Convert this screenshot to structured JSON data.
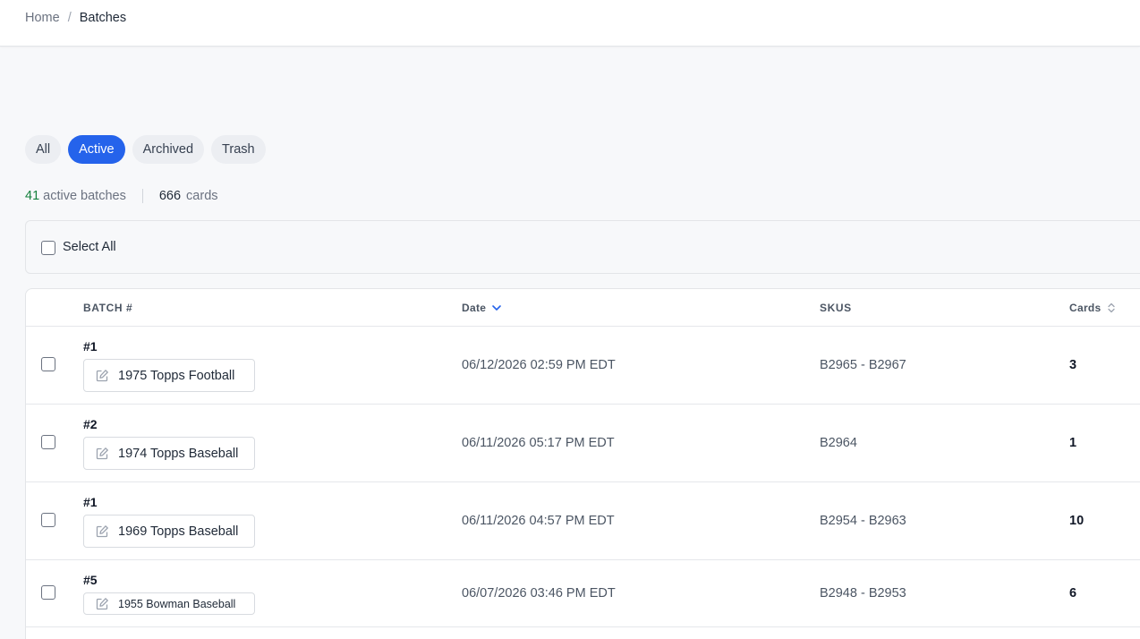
{
  "breadcrumb": {
    "home": "Home",
    "separator": "/",
    "current": "Batches"
  },
  "tabs": [
    {
      "label": "All",
      "active": false
    },
    {
      "label": "Active",
      "active": true
    },
    {
      "label": "Archived",
      "active": false
    },
    {
      "label": "Trash",
      "active": false
    }
  ],
  "stats": {
    "active_count": "41",
    "active_label": "active batches",
    "cards_count": "666",
    "cards_label": "cards"
  },
  "select_all": {
    "label": "Select All",
    "checked": false
  },
  "table": {
    "headers": {
      "batch": "BATCH #",
      "date": "Date",
      "skus": "SKUS",
      "cards": "Cards"
    },
    "sort": {
      "column": "Date",
      "direction": "desc"
    },
    "rows": [
      {
        "batch_num": "#1",
        "name": "1975 Topps Football",
        "date": "06/12/2026 02:59 PM EDT",
        "skus": "B2965 - B2967",
        "cards": "3"
      },
      {
        "batch_num": "#2",
        "name": "1974 Topps Baseball",
        "date": "06/11/2026 05:17 PM EDT",
        "skus": "B2964",
        "cards": "1"
      },
      {
        "batch_num": "#1",
        "name": "1969 Topps Baseball",
        "date": "06/11/2026 04:57 PM EDT",
        "skus": "B2954 - B2963",
        "cards": "10"
      },
      {
        "batch_num": "#5",
        "name": "1955 Bowman Baseball",
        "date": "06/07/2026 03:46 PM EDT",
        "skus": "B2948 - B2953",
        "cards": "6"
      }
    ]
  },
  "colors": {
    "accent": "#2563eb",
    "stat_green": "#15803d",
    "background": "#f7f8fa"
  },
  "icons": {
    "row_edit": "pencil-square-icon",
    "date_sort": "chevron-down-icon",
    "cards_sort": "sort-up-down-icon"
  }
}
